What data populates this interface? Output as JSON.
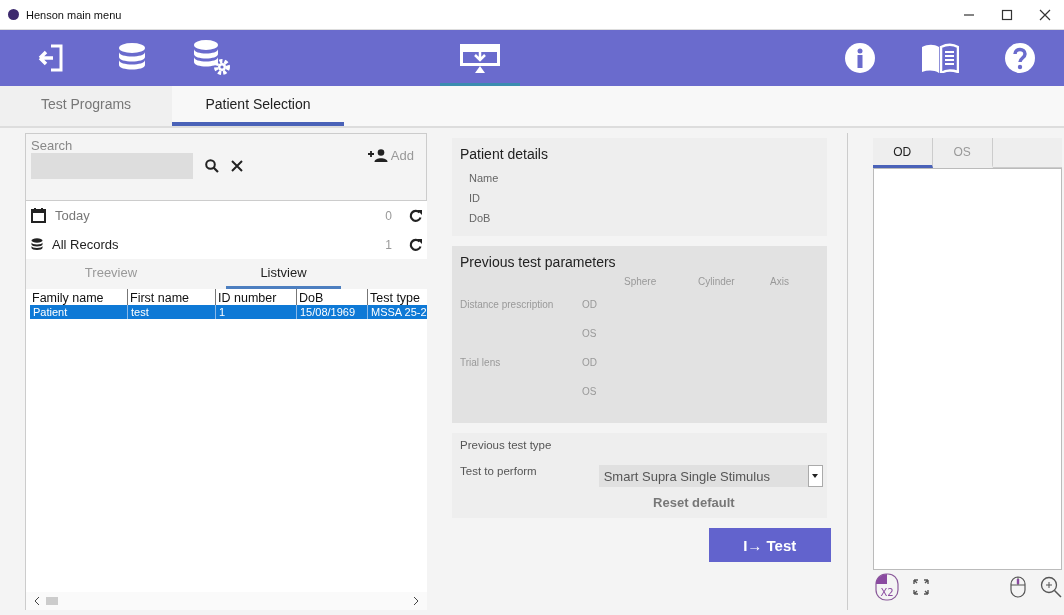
{
  "window": {
    "title": "Henson main menu"
  },
  "toolbar": [
    {
      "kind": "exit",
      "selected": false
    },
    {
      "kind": "database",
      "selected": false
    },
    {
      "kind": "database-settings",
      "selected": false
    },
    {
      "kind": "monitor",
      "selected": true
    },
    {
      "kind": "info",
      "selected": false
    },
    {
      "kind": "manual",
      "selected": false
    },
    {
      "kind": "help",
      "selected": false
    }
  ],
  "tabs": [
    {
      "label": "Test Programs",
      "selected": false
    },
    {
      "label": "Patient Selection",
      "selected": true
    }
  ],
  "search": {
    "label": "Search",
    "add_label": "Add"
  },
  "record_groups": [
    {
      "kind": "today",
      "label": "Today",
      "count": "0"
    },
    {
      "kind": "all",
      "label": "All Records",
      "count": "1"
    }
  ],
  "view_tabs": [
    {
      "label": "Treeview",
      "selected": false
    },
    {
      "label": "Listview",
      "selected": true
    }
  ],
  "table": {
    "columns": [
      "Family name",
      "First name",
      "ID number",
      "DoB",
      "Test type"
    ],
    "rows": [
      {
        "cells": [
          "Patient",
          "test",
          "1",
          "15/08/1969",
          "MSSA 25-2"
        ],
        "selected": true
      }
    ]
  },
  "patient_details": {
    "title": "Patient details",
    "fields": [
      "Name",
      "ID",
      "DoB"
    ]
  },
  "previous_test_parameters": {
    "title": "Previous test parameters",
    "columns": [
      "Sphere",
      "Cylinder",
      "Axis"
    ],
    "groups": [
      {
        "label": "Distance prescription",
        "eyes": [
          "OD",
          "OS"
        ]
      },
      {
        "label": "Trial lens",
        "eyes": [
          "OD",
          "OS"
        ]
      }
    ]
  },
  "test_selection": {
    "previous_label": "Previous test type",
    "perform_label": "Test to perform",
    "value": "Smart Supra Single Stimulus",
    "reset_label": "Reset default"
  },
  "test_button": {
    "label": "I→ Test"
  },
  "eye_tabs": [
    {
      "label": "OD",
      "selected": true
    },
    {
      "label": "OS",
      "selected": false
    }
  ],
  "viewer_tools": {
    "double_click_label": "X2"
  }
}
